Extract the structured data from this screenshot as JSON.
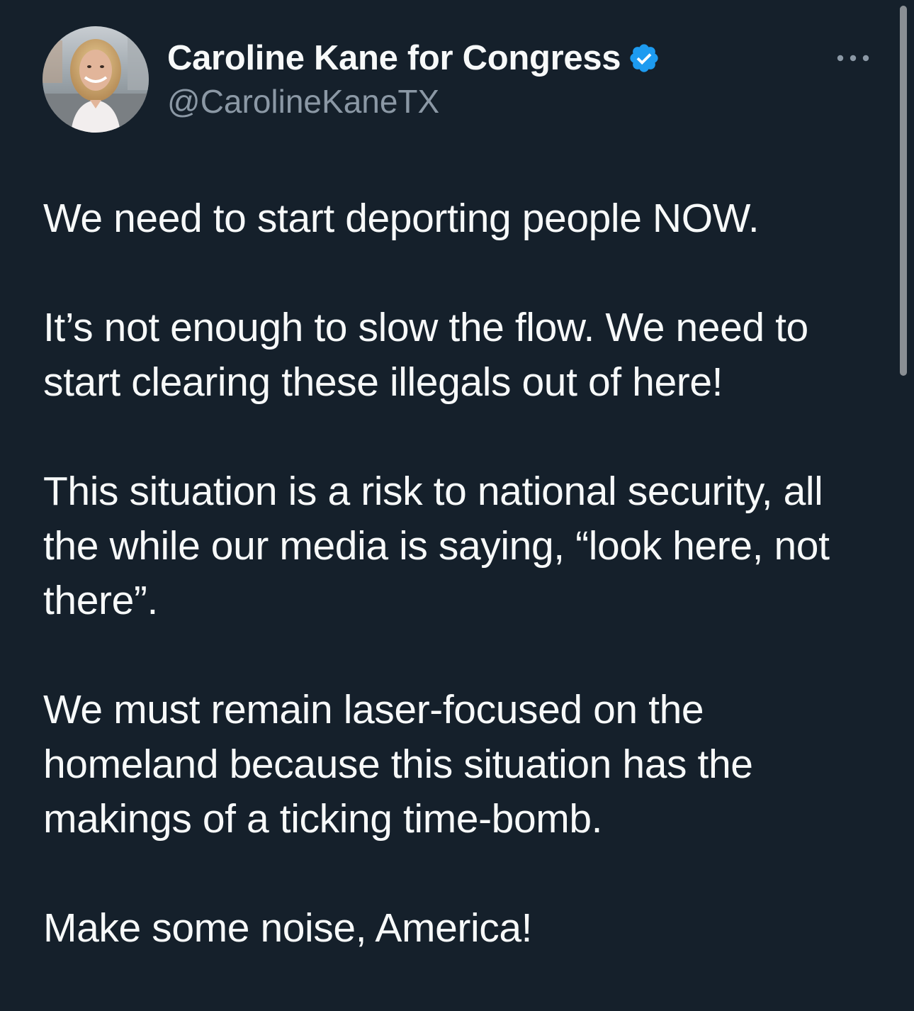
{
  "tweet": {
    "author": {
      "display_name": "Caroline Kane for Congress",
      "handle": "@CarolineKaneTX",
      "verified": true,
      "avatar_icon": "profile-photo"
    },
    "more_icon": "ellipsis-icon",
    "paragraphs": [
      "We need to start deporting people NOW.",
      "It’s not enough to slow the flow. We need to start clearing these illegals out of here!",
      "This situation is a risk to national security, all the while our media is saying, “look here, not there”.",
      "We must remain laser-focused on the homeland because this situation has the makings of a ticking time-bomb.",
      "Make some noise, America!"
    ]
  },
  "colors": {
    "background": "#15202b",
    "text": "#f7f9f9",
    "secondary_text": "#8b98a5",
    "verified_badge": "#1d9bf0",
    "scrollbar": "#8a8f94"
  }
}
